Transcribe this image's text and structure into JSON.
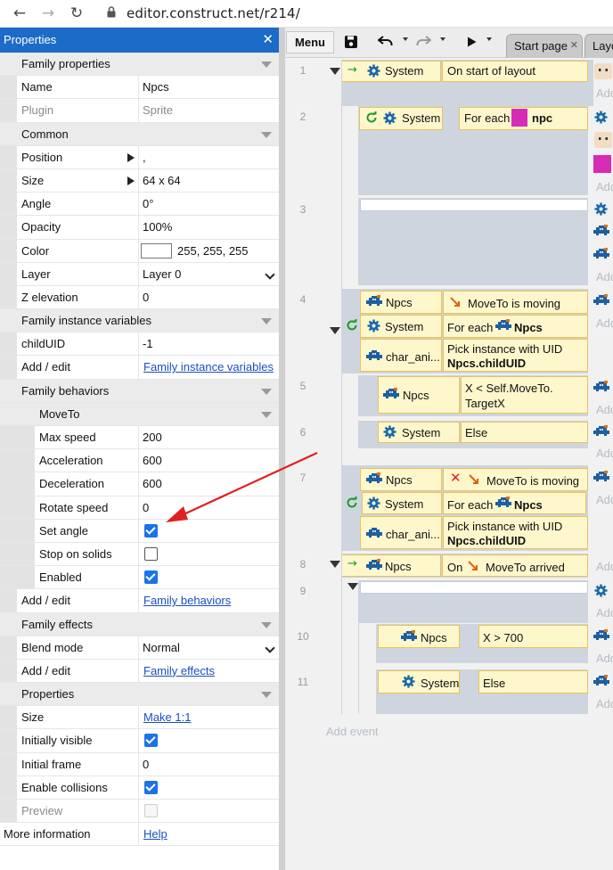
{
  "browser": {
    "url": "editor.construct.net/r214/"
  },
  "panel": {
    "title": "Properties",
    "rows": [
      {
        "t": "sec",
        "label": "Family properties"
      },
      {
        "t": "txt",
        "label": "Name",
        "value": "Npcs"
      },
      {
        "t": "gray",
        "label": "Plugin",
        "value": "Sprite"
      },
      {
        "t": "sec",
        "label": "Common"
      },
      {
        "t": "exp",
        "label": "Position",
        "value": ","
      },
      {
        "t": "exp",
        "label": "Size",
        "value": "64 x 64"
      },
      {
        "t": "txt",
        "label": "Angle",
        "value": "0°"
      },
      {
        "t": "txt",
        "label": "Opacity",
        "value": "100%"
      },
      {
        "t": "color",
        "label": "Color",
        "value": "255, 255, 255"
      },
      {
        "t": "select",
        "label": "Layer",
        "value": "Layer 0"
      },
      {
        "t": "txt",
        "label": "Z elevation",
        "value": "0"
      },
      {
        "t": "sec",
        "label": "Family instance variables"
      },
      {
        "t": "txt",
        "label": "childUID",
        "value": "-1"
      },
      {
        "t": "link",
        "label": "Add / edit",
        "value": "Family instance variables"
      },
      {
        "t": "sec",
        "label": "Family behaviors"
      },
      {
        "t": "secsub",
        "label": "MoveTo"
      },
      {
        "t": "subtxt",
        "label": "Max speed",
        "value": "200"
      },
      {
        "t": "subtxt",
        "label": "Acceleration",
        "value": "600"
      },
      {
        "t": "subtxt",
        "label": "Deceleration",
        "value": "600"
      },
      {
        "t": "subtxt",
        "label": "Rotate speed",
        "value": "0"
      },
      {
        "t": "subcheck",
        "label": "Set angle",
        "checked": true
      },
      {
        "t": "subcheck",
        "label": "Stop on solids",
        "checked": false
      },
      {
        "t": "subcheck",
        "label": "Enabled",
        "checked": true
      },
      {
        "t": "link",
        "label": "Add / edit",
        "value": "Family behaviors"
      },
      {
        "t": "sec",
        "label": "Family effects"
      },
      {
        "t": "select",
        "label": "Blend mode",
        "value": "Normal"
      },
      {
        "t": "link",
        "label": "Add / edit",
        "value": "Family effects"
      },
      {
        "t": "sec",
        "label": "Properties"
      },
      {
        "t": "link",
        "label": "Size",
        "value": "Make 1:1"
      },
      {
        "t": "check",
        "label": "Initially visible",
        "checked": true
      },
      {
        "t": "txt",
        "label": "Initial frame",
        "value": "0"
      },
      {
        "t": "check",
        "label": "Enable collisions",
        "checked": true
      },
      {
        "t": "graycheck",
        "label": "Preview",
        "checked": false
      },
      {
        "t": "linkroot",
        "label": "More information",
        "value": "Help"
      }
    ]
  },
  "toolbar": {
    "menu_label": "Menu",
    "tabs": [
      "Start page",
      "Layo"
    ]
  },
  "events": {
    "line_numbers": [
      "1",
      "2",
      "3",
      "4",
      "5",
      "6",
      "7",
      "8",
      "9",
      "10",
      "11"
    ],
    "e1": {
      "obj": "System",
      "cond": "On start of layout"
    },
    "e2": {
      "obj": "System",
      "cond": "For each",
      "cond_obj": "npc"
    },
    "e4": {
      "r1_obj": "Npcs",
      "r1_cond": "MoveTo is moving",
      "r2_obj": "System",
      "r2_cond": "For each",
      "r2_cond_obj": "Npcs",
      "r3_obj": "char_ani...",
      "r3_l1": "Pick instance with UID",
      "r3_l2": "Npcs.childUID"
    },
    "e5": {
      "obj": "Npcs",
      "l1": "X < Self.MoveTo.",
      "l2": "TargetX"
    },
    "e6": {
      "obj": "System",
      "cond": "Else"
    },
    "e7": {
      "r1_obj": "Npcs",
      "r1_cond": "MoveTo is moving",
      "r2_obj": "System",
      "r2_cond": "For each",
      "r2_cond_obj": "Npcs",
      "r3_obj": "char_ani...",
      "r3_l1": "Pick instance with UID",
      "r3_l2": "Npcs.childUID"
    },
    "e8": {
      "obj": "Npcs",
      "cond_pre": "On",
      "cond": "MoveTo arrived"
    },
    "e10": {
      "obj": "Npcs",
      "cond": "X > 700"
    },
    "e11": {
      "obj": "System",
      "cond": "Else"
    },
    "add_action": "Add",
    "add_event": "Add event"
  },
  "colors": {
    "accent": "#1d6bc8",
    "highlight": "#fff7cc",
    "checkbox": "#1a73e8",
    "npc_swatch": "#d62bb5",
    "arrow": "#e02020"
  }
}
